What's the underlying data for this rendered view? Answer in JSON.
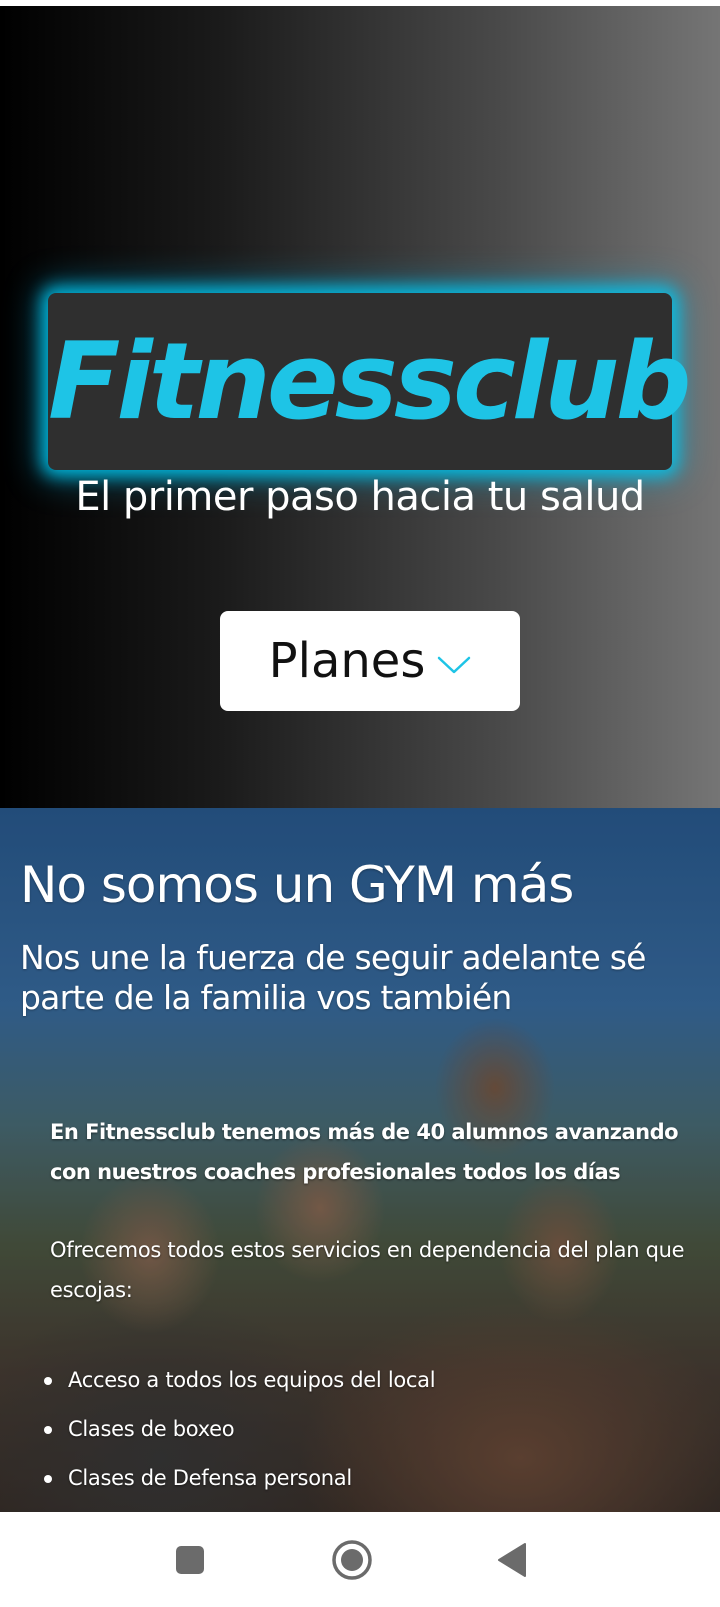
{
  "hero": {
    "logo_text": "Fitnessclub",
    "tagline": "El primer paso hacia tu salud",
    "planes_button_label": "Planes",
    "accent_color": "#1ec4e6"
  },
  "about": {
    "title": "No somos un GYM más",
    "subtitle": "Nos une la fuerza de seguir adelante sé parte de la familia vos también",
    "intro": "En Fitnessclub tenemos más de 40 alumnos avanzando con nuestros coaches profesionales todos los días",
    "services_intro": "Ofrecemos todos estos servicios en dependencia del plan que escojas:",
    "services": [
      "Acceso a todos los equipos del local",
      "Clases de boxeo",
      "Clases de Defensa personal"
    ]
  },
  "navigation_bar": {
    "icons": [
      "recent-apps-icon",
      "home-icon",
      "back-icon"
    ]
  }
}
